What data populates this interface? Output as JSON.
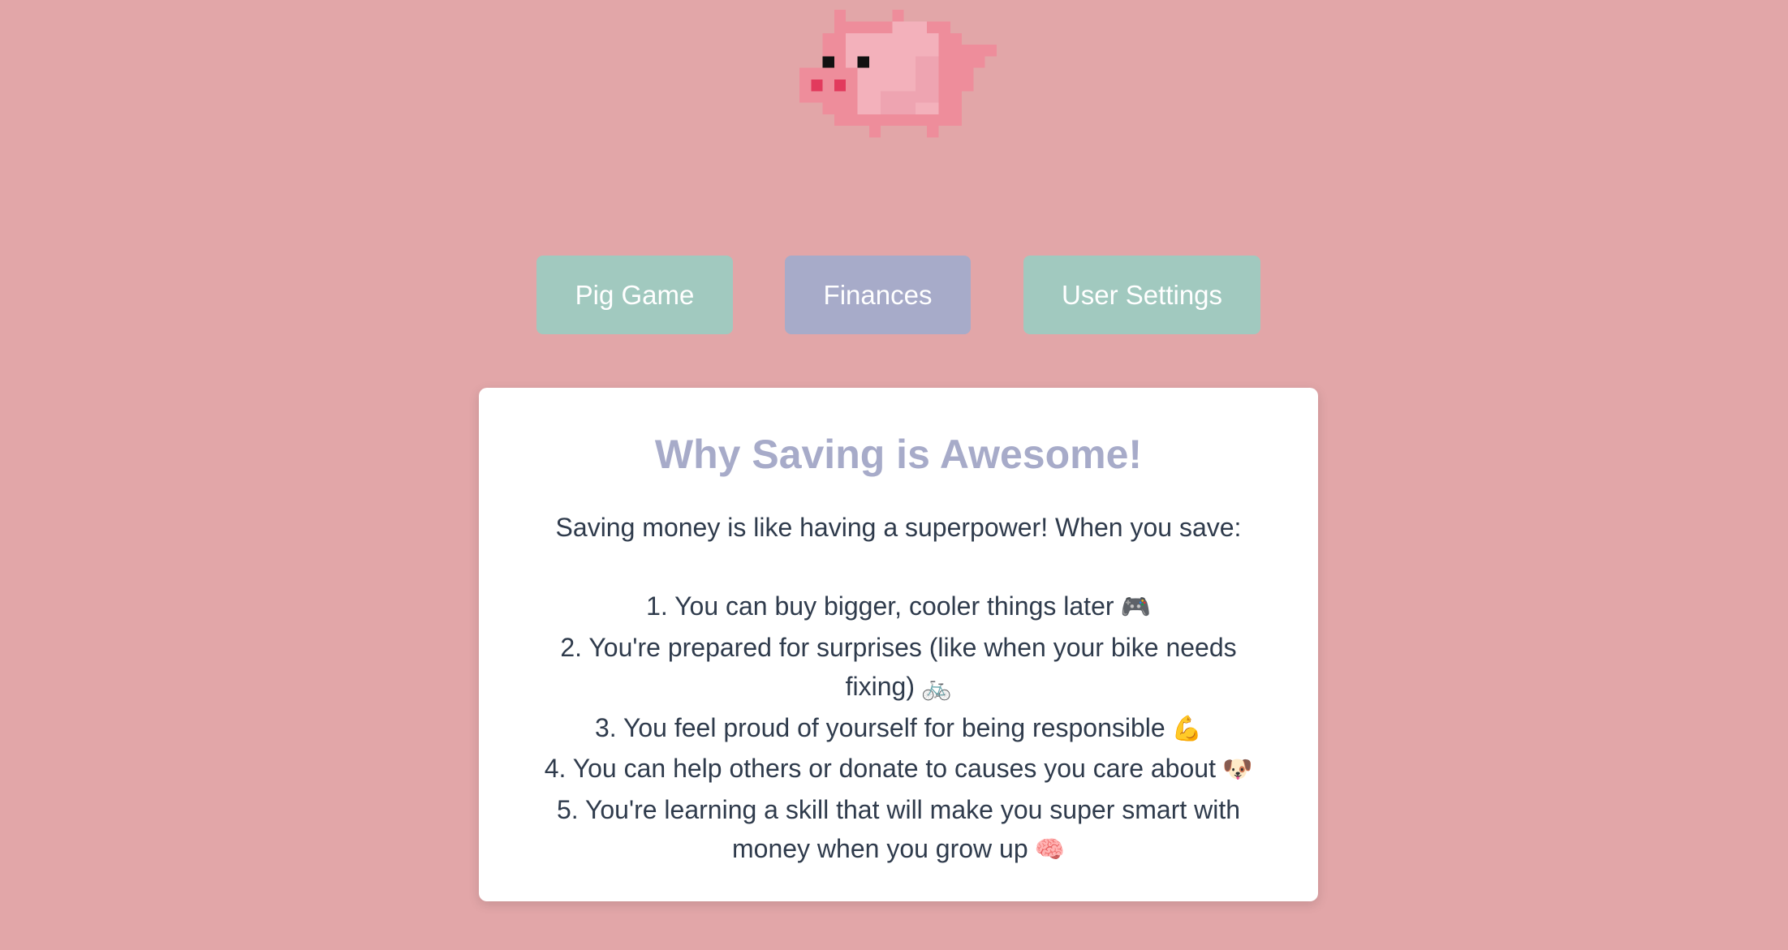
{
  "header": {
    "logo": "pixel-pig-logo"
  },
  "nav": {
    "items": [
      {
        "label": "Pig Game",
        "color": "#a1c9bf"
      },
      {
        "label": "Finances",
        "color": "#a7abc9",
        "active": true
      },
      {
        "label": "User Settings",
        "color": "#a1c9bf"
      }
    ]
  },
  "card": {
    "title": "Why Saving is Awesome!",
    "intro": "Saving money is like having a superpower! When you save:",
    "items": [
      {
        "text": "1. You can buy bigger, cooler things later",
        "emoji": "🎮"
      },
      {
        "text": "2. You're prepared for surprises (like when your bike needs fixing)",
        "emoji": "🚲"
      },
      {
        "text": "3. You feel proud of yourself for being responsible",
        "emoji": "💪"
      },
      {
        "text": "4. You can help others or donate to causes you care about",
        "emoji": "🐶"
      },
      {
        "text": "5. You're learning a skill that will make you super smart with money when you grow up",
        "emoji": "🧠"
      }
    ]
  },
  "colors": {
    "background": "#e2a6a8",
    "accent_green": "#a1c9bf",
    "accent_purple": "#a7abc9",
    "text": "#2f3b4c"
  }
}
